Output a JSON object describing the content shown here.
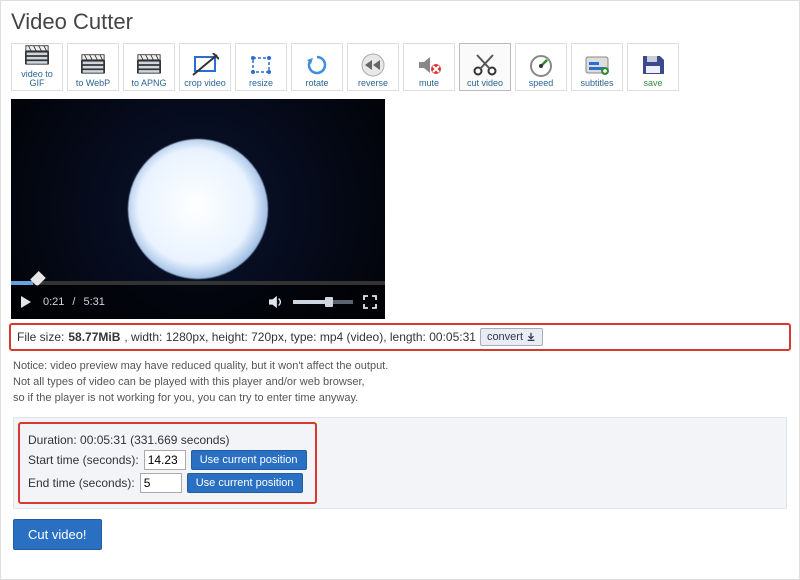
{
  "page_title": "Video Cutter",
  "toolbar": [
    {
      "id": "video-to-gif",
      "label": "video to GIF"
    },
    {
      "id": "to-webp",
      "label": "to WebP"
    },
    {
      "id": "to-apng",
      "label": "to APNG"
    },
    {
      "id": "crop-video",
      "label": "crop video"
    },
    {
      "id": "resize",
      "label": "resize"
    },
    {
      "id": "rotate",
      "label": "rotate"
    },
    {
      "id": "reverse",
      "label": "reverse"
    },
    {
      "id": "mute",
      "label": "mute"
    },
    {
      "id": "cut-video",
      "label": "cut video",
      "active": true
    },
    {
      "id": "speed",
      "label": "speed"
    },
    {
      "id": "subtitles",
      "label": "subtitles"
    },
    {
      "id": "save",
      "label": "save"
    }
  ],
  "player": {
    "current_time": "0:21",
    "total_time": "5:31",
    "time_sep": "/"
  },
  "file_info": {
    "size_label": "File size:",
    "size_value": "58.77MiB",
    "rest": ", width: 1280px, height: 720px, type: mp4 (video), length: 00:05:31",
    "convert_label": "convert"
  },
  "notice_lines": [
    "Notice: video preview may have reduced quality, but it won't affect the output.",
    "Not all types of video can be played with this player and/or web browser,",
    "so if the player is not working for you, you can try to enter time anyway."
  ],
  "trim": {
    "duration": "Duration: 00:05:31 (331.669 seconds)",
    "start_label": "Start time (seconds):",
    "start_value": "14.23",
    "end_label": "End time (seconds):",
    "end_value": "5",
    "use_position": "Use current position"
  },
  "cut_button": "Cut video!"
}
